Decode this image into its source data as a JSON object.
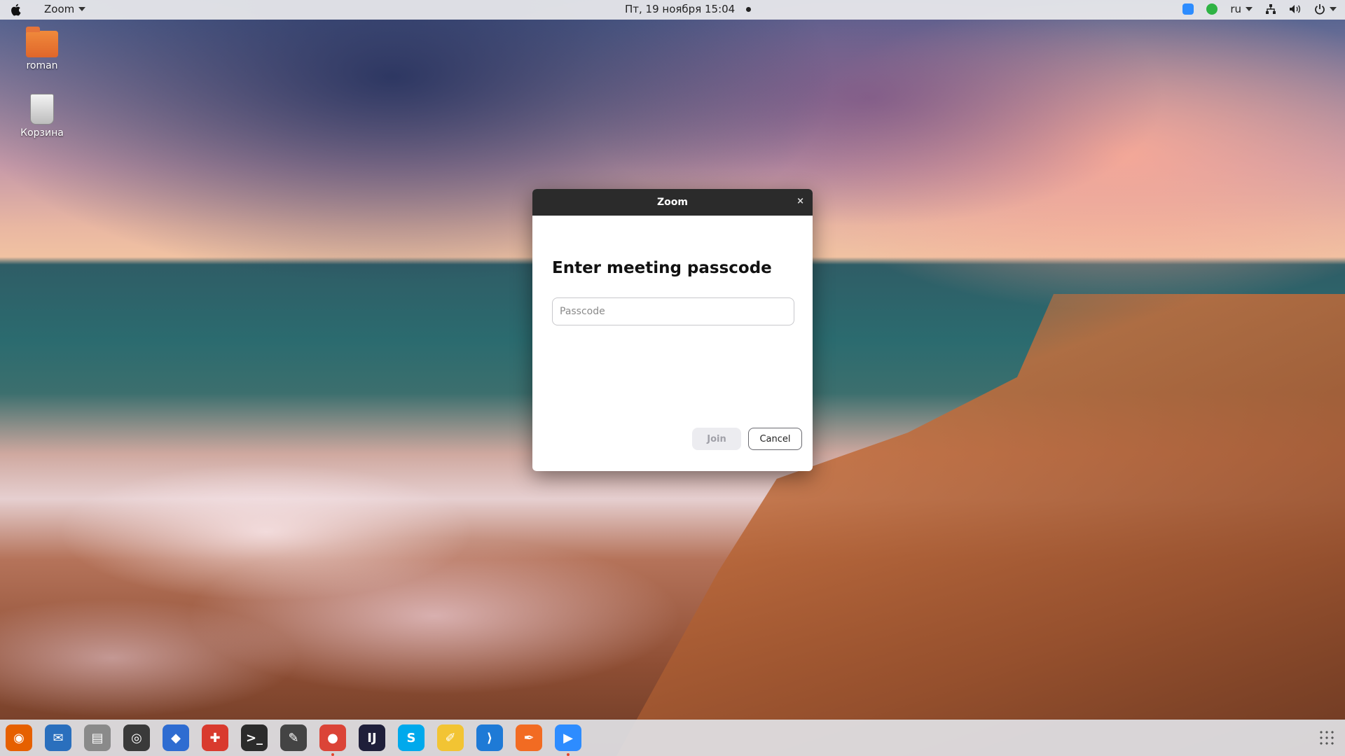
{
  "topbar": {
    "app_name": "Zoom",
    "clock": "Пт, 19 ноября  15:04",
    "language": "ru"
  },
  "desktop": {
    "icons": [
      {
        "label": "roman",
        "icon": "home-folder-icon"
      },
      {
        "label": "Корзина",
        "icon": "trash-icon"
      }
    ]
  },
  "dialog": {
    "title": "Zoom",
    "close_glyph": "×",
    "heading": "Enter meeting passcode",
    "passcode_placeholder": "Passcode",
    "passcode_value": "",
    "join_label": "Join",
    "cancel_label": "Cancel"
  },
  "dock": {
    "apps": [
      {
        "name": "firefox-icon",
        "glyph": "◉",
        "color": "#e66000"
      },
      {
        "name": "thunderbird-icon",
        "glyph": "✉",
        "color": "#2a6fbd"
      },
      {
        "name": "files-icon",
        "glyph": "▤",
        "color": "#8a8a8a"
      },
      {
        "name": "rhythmbox-icon",
        "glyph": "◎",
        "color": "#3a3a3a"
      },
      {
        "name": "app-store-icon",
        "glyph": "◆",
        "color": "#2e6cd1"
      },
      {
        "name": "help-icon",
        "glyph": "✚",
        "color": "#d93a2e"
      },
      {
        "name": "terminal-icon",
        "glyph": ">_",
        "color": "#2b2b2b"
      },
      {
        "name": "inkscape-icon",
        "glyph": "✎",
        "color": "#444"
      },
      {
        "name": "chrome-icon",
        "glyph": "●",
        "color": "#db4437"
      },
      {
        "name": "intellij-icon",
        "glyph": "IJ",
        "color": "#1f1f3a"
      },
      {
        "name": "skype-icon",
        "glyph": "S",
        "color": "#00a9ec"
      },
      {
        "name": "text-editor-icon",
        "glyph": "✐",
        "color": "#f2c433"
      },
      {
        "name": "vscode-icon",
        "glyph": "⟩",
        "color": "#1e7ad6"
      },
      {
        "name": "draw-icon",
        "glyph": "✒",
        "color": "#f26b22"
      },
      {
        "name": "zoom-icon",
        "glyph": "▶",
        "color": "#2d8cff"
      }
    ]
  }
}
